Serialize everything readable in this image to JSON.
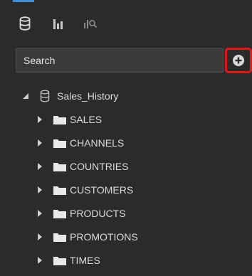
{
  "toolbar": {
    "tabs": [
      {
        "icon": "database-icon",
        "active": true
      },
      {
        "icon": "bar-chart-icon",
        "active": false
      },
      {
        "icon": "chart-search-icon",
        "active": false
      }
    ]
  },
  "search": {
    "placeholder": "Search",
    "value": ""
  },
  "add_button": {
    "icon": "plus-circle-icon",
    "highlight_color": "#e01a1a"
  },
  "tree": {
    "root": {
      "label": "Sales_History",
      "expanded": true,
      "icon": "database-icon"
    },
    "children": [
      {
        "label": "SALES"
      },
      {
        "label": "CHANNELS"
      },
      {
        "label": "COUNTRIES"
      },
      {
        "label": "CUSTOMERS"
      },
      {
        "label": "PRODUCTS"
      },
      {
        "label": "PROMOTIONS"
      },
      {
        "label": "TIMES"
      }
    ]
  },
  "colors": {
    "background": "#2b2b2b",
    "accent": "#3d8fd6",
    "text": "#dadada",
    "folder": "#e8e8e8"
  }
}
